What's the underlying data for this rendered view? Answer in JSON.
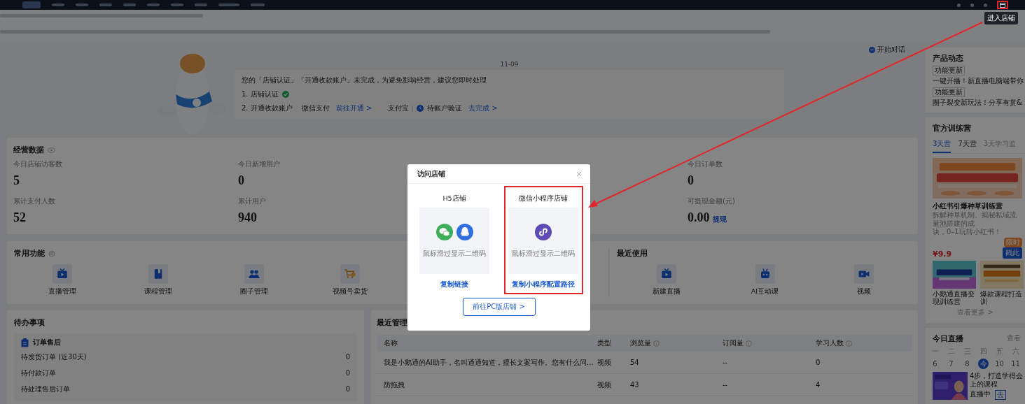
{
  "top_nav": {
    "nav_items": [
      {
        "selected": true
      },
      {
        "selected": false
      },
      {
        "selected": false
      },
      {
        "selected": false
      },
      {
        "selected": false
      },
      {
        "selected": false
      },
      {
        "selected": false
      },
      {
        "selected": false
      },
      {
        "selected": false
      },
      {
        "selected": false
      }
    ],
    "store_button": {
      "highlighted": true
    },
    "tooltip": "进入店铺"
  },
  "welcome": {
    "chat_button": "开始对话",
    "date": "11-09",
    "message": "您的「店铺认证」「开通收款账户」未完成，为避免影响经营，建议您即时处理",
    "step_1": {
      "label": "1. 店铺认证",
      "done": true
    },
    "step_2": {
      "label": "2. 开通收款账户",
      "wechat_pay": "微信支付",
      "wechat_link": "前往开通 >",
      "alipay": "支付宝",
      "alipay_status": "待账户验证",
      "alipay_link": "去完成 >"
    }
  },
  "stats": {
    "title": "经营数据",
    "columns": [
      {
        "items": [
          {
            "label": "今日店铺访客数",
            "value": "5"
          },
          {
            "label": "累计支付人数",
            "value": "52"
          }
        ]
      },
      {
        "items": [
          {
            "label": "今日新增用户",
            "value": "0"
          },
          {
            "label": "累计用户",
            "value": "940"
          }
        ]
      },
      {
        "items": [
          {
            "label": "今日订单数",
            "value": "0"
          },
          {
            "label": "可提现金额(元)",
            "value": "0.00",
            "link": "提现"
          }
        ]
      }
    ]
  },
  "functions": {
    "title": "常用功能",
    "items": [
      {
        "label": "直播管理",
        "kind": "tv"
      },
      {
        "label": "课程管理",
        "kind": "book"
      },
      {
        "label": "圈子管理",
        "kind": "people"
      },
      {
        "label": "视频号卖货",
        "kind": "cart"
      }
    ]
  },
  "recent_use": {
    "title": "最近使用",
    "items": [
      {
        "label": "新建直播",
        "kind": "tv"
      },
      {
        "label": "AI互动课",
        "kind": "robot"
      },
      {
        "label": "视频",
        "kind": "video"
      }
    ]
  },
  "todo": {
    "title": "待办事项",
    "group": "订单售后",
    "rows": [
      {
        "label": "待发货订单 (近30天)",
        "count": "0"
      },
      {
        "label": "待付款订单",
        "count": "0"
      },
      {
        "label": "待处理售后订单",
        "count": "0"
      }
    ]
  },
  "recent_manage": {
    "title": "最近管理",
    "columns": [
      {
        "label": "名称",
        "info": false
      },
      {
        "label": "类型",
        "info": false
      },
      {
        "label": "浏览量",
        "info": true
      },
      {
        "label": "订阅量",
        "info": true
      },
      {
        "label": "学习人数",
        "info": true
      }
    ],
    "rows": [
      [
        "我是小鹅通的AI助手，名叫通通知道，擅长文案写作。您有什么问…",
        "视频",
        "54",
        "--",
        "0"
      ],
      [
        "防拖拽",
        "视频",
        "43",
        "--",
        "4"
      ]
    ]
  },
  "sidebar": {
    "news": {
      "title": "产品动态",
      "items": [
        {
          "tag": "功能更新",
          "text": "一键开播！新直播电脑端带你"
        },
        {
          "tag": "功能更新",
          "text": "圈子裂变新玩法！分享有赏&"
        }
      ]
    },
    "camp": {
      "title": "官方训练营",
      "tabs": [
        {
          "label": "3天营",
          "selected": true
        },
        {
          "label": "7天营",
          "selected": false
        },
        {
          "label": "3天学习监",
          "selected": false
        }
      ],
      "course": {
        "kind": "picture",
        "title": "小红书引爆种草训练营",
        "desc_lines": [
          "拆解种草机制、揭秘私域流量池搭建的成",
          "诀，0–1玩转小红书！"
        ],
        "price": "¥9.9",
        "badge": "限时",
        "button": "戳此"
      },
      "thumbs": [
        {
          "kind": "picture",
          "caption": "小鹅通直播变现训练营"
        },
        {
          "kind": "picture",
          "caption": "爆款课程打造训"
        }
      ],
      "more": "查看更多 >"
    },
    "live": {
      "title": "今日直播",
      "more": "查看",
      "weekdays": [
        "一",
        "二",
        "三",
        "四",
        "五",
        "六"
      ],
      "dates": [
        {
          "label": "6",
          "selected": false
        },
        {
          "label": "7",
          "selected": false
        },
        {
          "label": "8",
          "selected": false
        },
        {
          "label": "今",
          "selected": true
        },
        {
          "label": "10",
          "selected": false
        },
        {
          "label": "11",
          "selected": false
        }
      ],
      "item": {
        "kind": "picture",
        "title_lines": [
          "4步，打造学得会",
          "上的课程"
        ],
        "status": "直播中",
        "button": "去"
      }
    }
  },
  "modal": {
    "title": "访问店铺",
    "options": [
      {
        "title": "H5店铺",
        "kind": "h5",
        "hint": "鼠标滑过显示二维码",
        "link": "复制链接",
        "highlighted": false
      },
      {
        "title": "微信小程序店铺",
        "kind": "miniprogram",
        "hint": "鼠标滑过显示二维码",
        "link": "复制小程序配置路径",
        "highlighted": true
      }
    ],
    "button": "前往PC版店铺 >"
  }
}
